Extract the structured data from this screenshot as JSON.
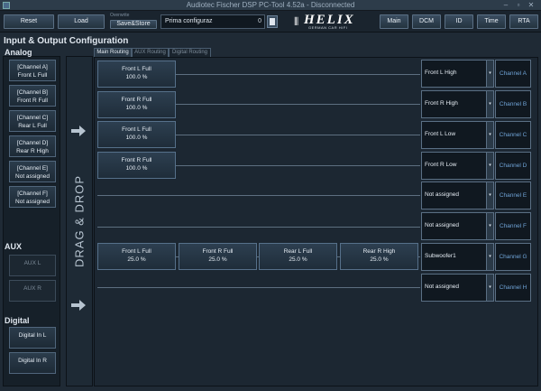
{
  "window": {
    "title": "Audiotec Fischer DSP PC-Tool 4.52a - Disconnected"
  },
  "toolbar": {
    "reset_label": "Reset",
    "load_label": "Load",
    "preset_label": "Overwrite",
    "save_label": "Save&Store",
    "preset_name": "Prima configuraz",
    "preset_number": "0",
    "nav": [
      "Main",
      "DCM",
      "ID",
      "Time",
      "RTA"
    ]
  },
  "logo": {
    "brand": "HELIX",
    "tagline": "GERMAN CAR HIFI"
  },
  "page": {
    "title": "Input & Output Configuration"
  },
  "left": {
    "analog_title": "Analog",
    "analog": [
      {
        "line1": "[Channel A]",
        "line2": "Front L Full"
      },
      {
        "line1": "[Channel B]",
        "line2": "Front R Full"
      },
      {
        "line1": "[Channel C]",
        "line2": "Rear L Full"
      },
      {
        "line1": "[Channel D]",
        "line2": "Rear R High"
      },
      {
        "line1": "[Channel E]",
        "line2": "Not assigned"
      },
      {
        "line1": "[Channel F]",
        "line2": "Not assigned"
      }
    ],
    "aux_title": "AUX",
    "aux": [
      "AUX L",
      "AUX R"
    ],
    "digital_title": "Digital",
    "digital": [
      "Digital In L",
      "Digital In R"
    ]
  },
  "dragdrop": {
    "text": "DRAG & DROP"
  },
  "tabs": [
    "Main Routing",
    "AUX Routing",
    "Digital Routing"
  ],
  "routing": {
    "rows": [
      {
        "sources": [
          {
            "name": "Front L Full",
            "level": "100.0 %"
          }
        ],
        "output": "Front L High",
        "channel": "Channel A"
      },
      {
        "sources": [
          {
            "name": "Front R Full",
            "level": "100.0 %"
          }
        ],
        "output": "Front R High",
        "channel": "Channel B"
      },
      {
        "sources": [
          {
            "name": "Front L Full",
            "level": "100.0 %"
          }
        ],
        "output": "Front L Low",
        "channel": "Channel C"
      },
      {
        "sources": [
          {
            "name": "Front R Full",
            "level": "100.0 %"
          }
        ],
        "output": "Front R Low",
        "channel": "Channel D"
      },
      {
        "sources": [],
        "output": "Not assigned",
        "channel": "Channel E"
      },
      {
        "sources": [],
        "output": "Not assigned",
        "channel": "Channel F"
      },
      {
        "sources": [
          {
            "name": "Front L Full",
            "level": "25.0 %"
          },
          {
            "name": "Front R Full",
            "level": "25.0 %"
          },
          {
            "name": "Rear L Full",
            "level": "25.0 %"
          },
          {
            "name": "Rear R High",
            "level": "25.0 %"
          }
        ],
        "output": "Subwoofer1",
        "channel": "Channel G"
      },
      {
        "sources": [],
        "output": "Not assigned",
        "channel": "Channel H"
      }
    ]
  }
}
